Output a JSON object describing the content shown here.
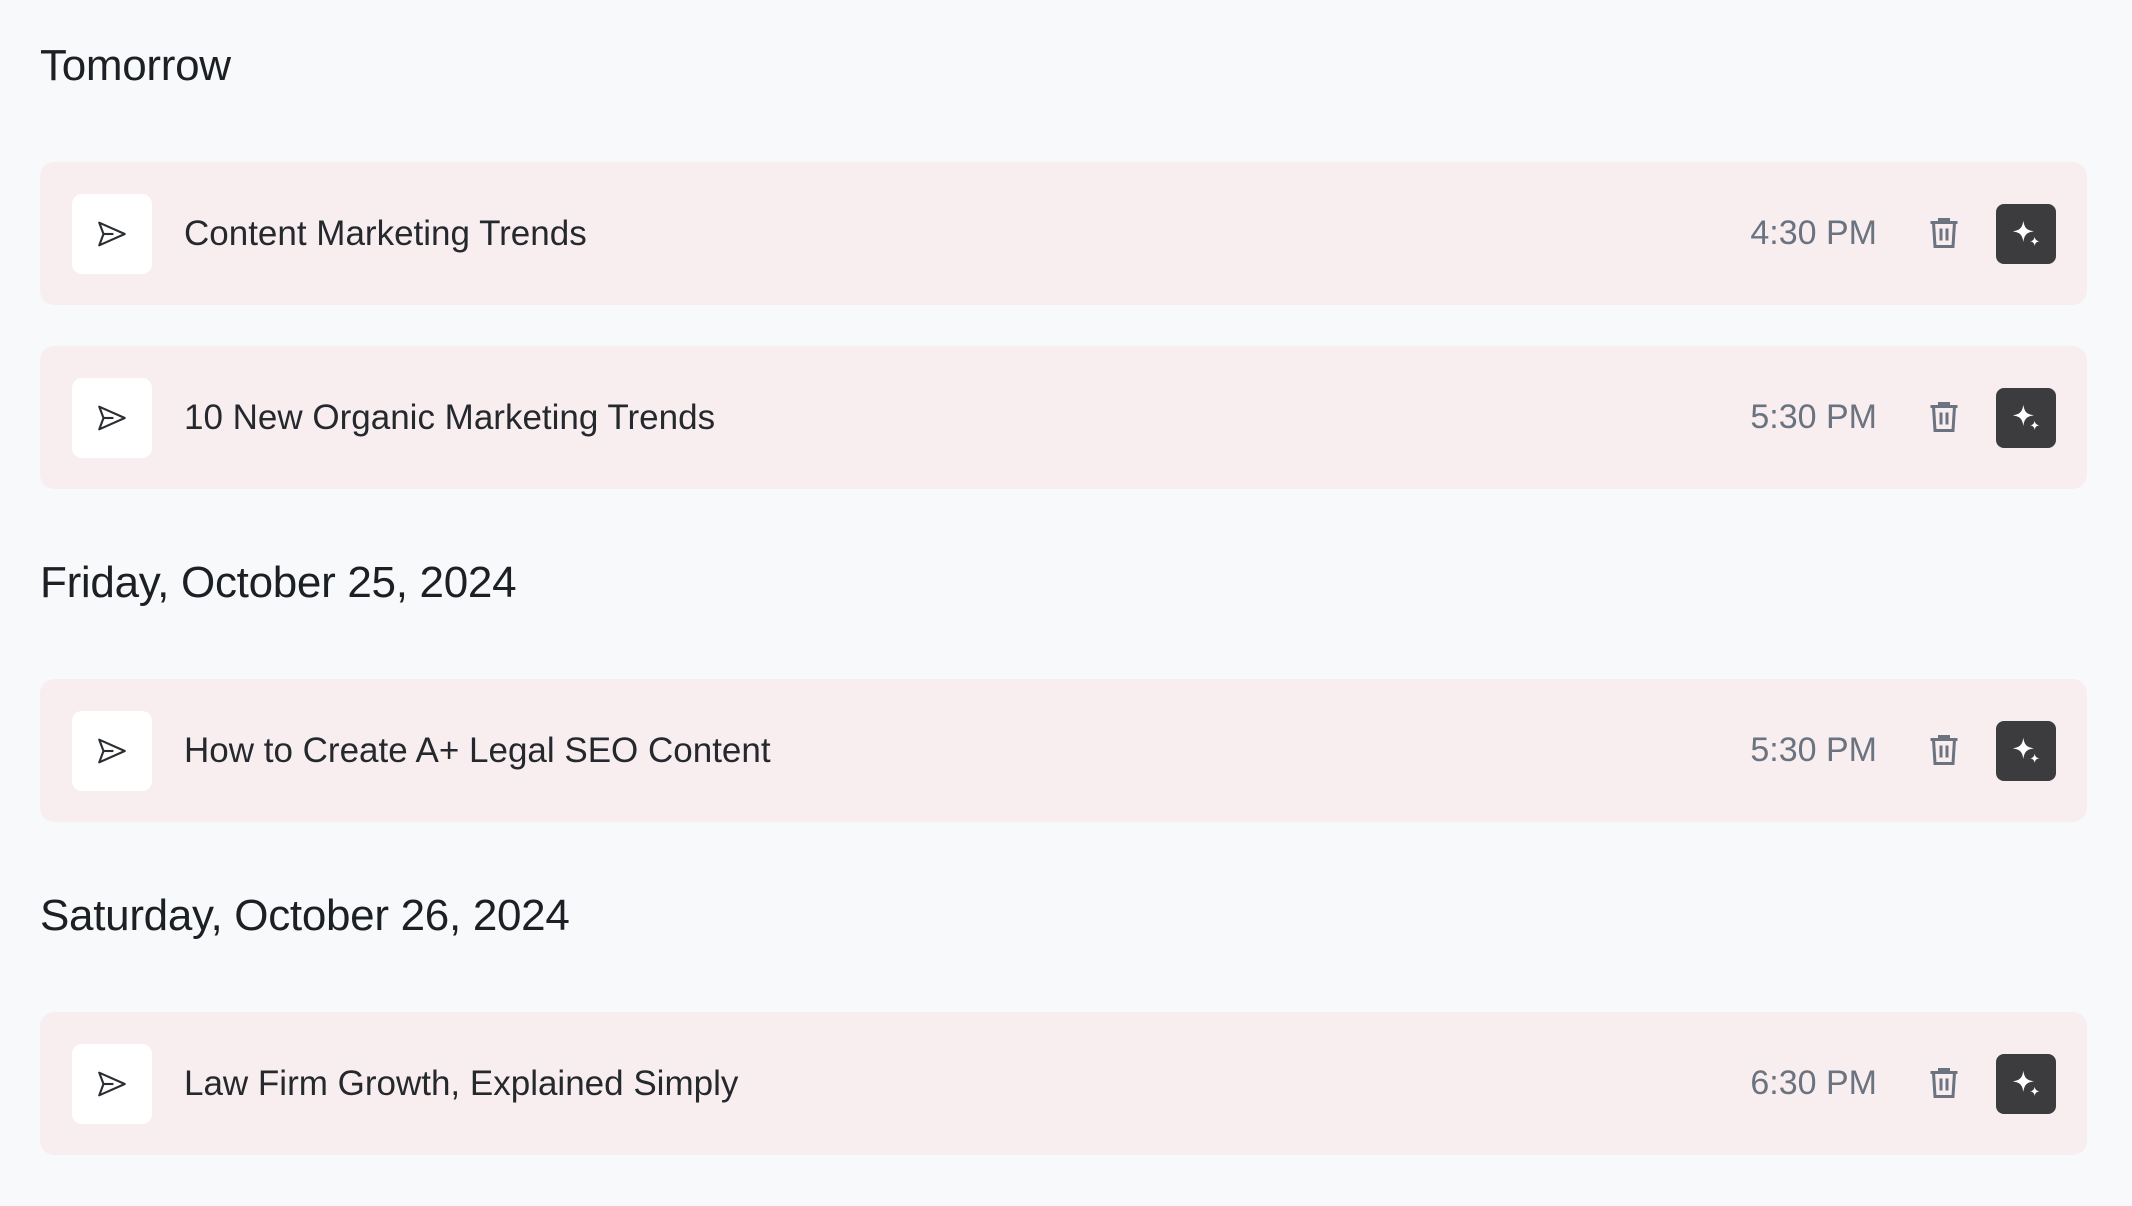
{
  "groups": [
    {
      "heading": "Tomorrow",
      "items": [
        {
          "title": "Content Marketing Trends",
          "time": "4:30 PM"
        },
        {
          "title": "10 New Organic Marketing Trends",
          "time": "5:30 PM"
        }
      ]
    },
    {
      "heading": "Friday, October 25, 2024",
      "items": [
        {
          "title": "How to Create A+ Legal SEO Content",
          "time": "5:30 PM"
        }
      ]
    },
    {
      "heading": "Saturday, October 26, 2024",
      "items": [
        {
          "title": "Law Firm Growth, Explained Simply",
          "time": "6:30 PM"
        }
      ]
    }
  ],
  "icons": {
    "row_icon": "send-icon",
    "delete": "trash-icon",
    "ai": "sparkle-icon"
  },
  "colors": {
    "background": "#f8f9fb",
    "row_background": "#f8eeef",
    "time_text": "#6b7380",
    "ai_button": "#3c3c3e"
  }
}
